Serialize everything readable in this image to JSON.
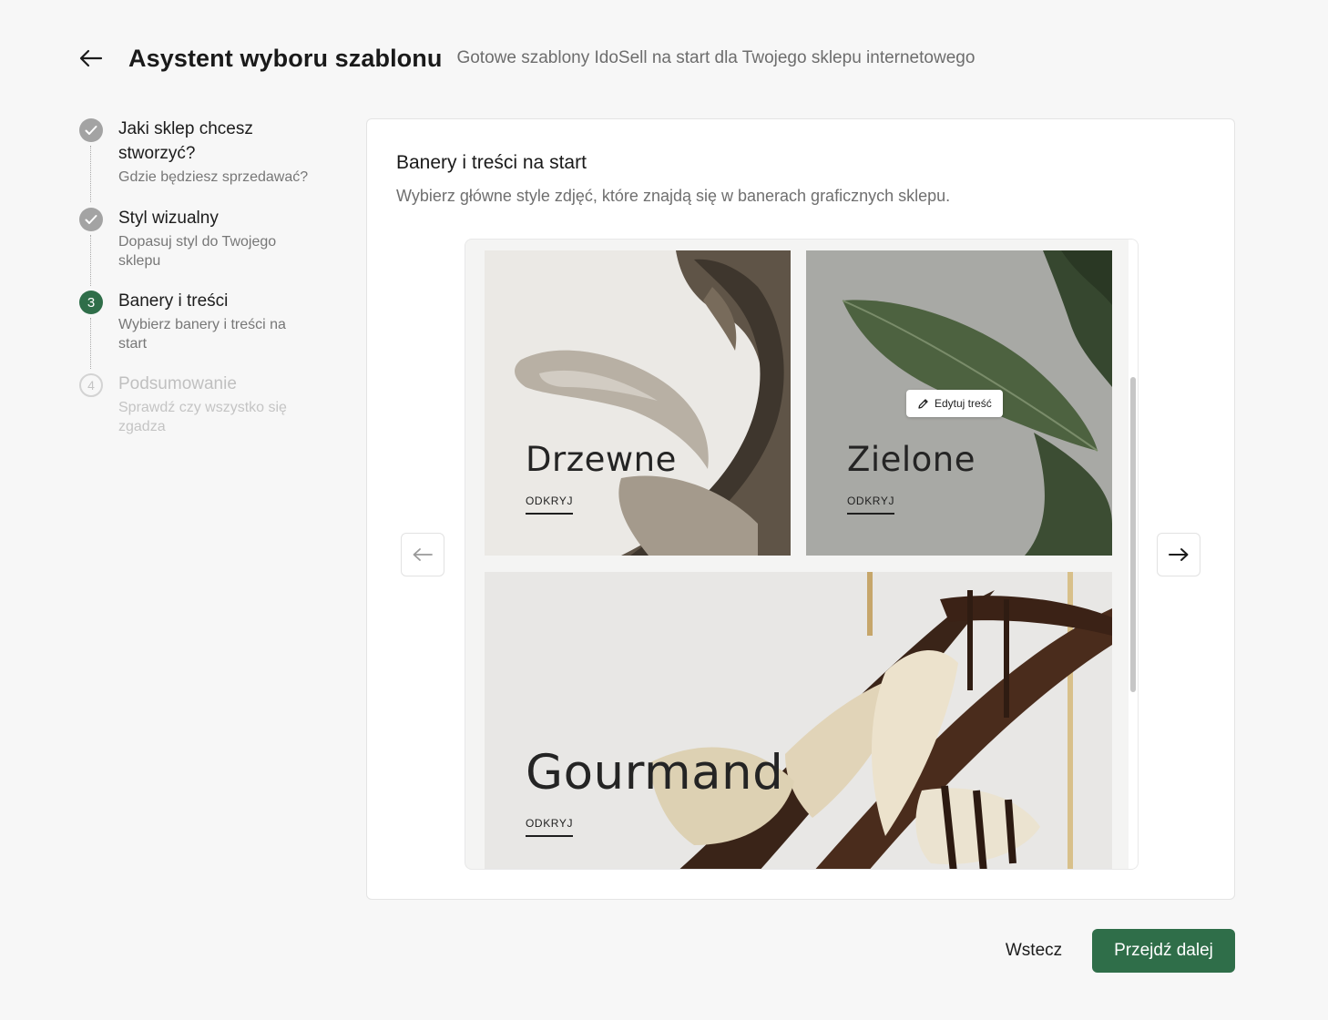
{
  "header": {
    "title": "Asystent wyboru szablonu",
    "subtitle": "Gotowe szablony IdoSell na start dla Twojego sklepu internetowego"
  },
  "steps": [
    {
      "title": "Jaki sklep chcesz stworzyć?",
      "desc": "Gdzie będziesz sprzedawać?",
      "state": "done"
    },
    {
      "title": "Styl wizualny",
      "desc": "Dopasuj styl do Twojego sklepu",
      "state": "done"
    },
    {
      "number": "3",
      "title": "Banery i treści",
      "desc": "Wybierz banery i treści na start",
      "state": "active"
    },
    {
      "number": "4",
      "title": "Podsumowanie",
      "desc": "Sprawdź czy wszystko się zgadza",
      "state": "future"
    }
  ],
  "card": {
    "title": "Banery i treści na start",
    "desc": "Wybierz główne style zdjęć, które znajdą się w banerach graficznych sklepu."
  },
  "banners": [
    {
      "label": "Drzewne",
      "cta": "ODKRYJ"
    },
    {
      "label": "Zielone",
      "cta": "ODKRYJ",
      "edit": "Edytuj treść"
    },
    {
      "label": "Gourmand",
      "cta": "ODKRYJ"
    }
  ],
  "footer": {
    "back_label": "Wstecz",
    "next_label": "Przejdź dalej"
  },
  "colors": {
    "accent": "#2f6e49",
    "done_step": "#a3a3a3",
    "background": "#f7f7f7"
  },
  "icons": [
    "arrow-left-icon",
    "check-icon",
    "pencil-icon",
    "arrow-right-icon"
  ]
}
